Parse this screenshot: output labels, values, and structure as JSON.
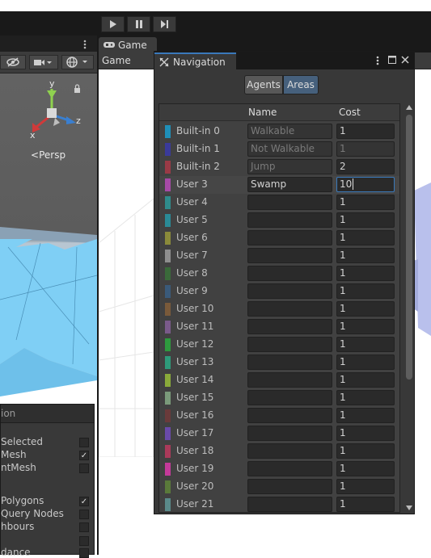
{
  "toolbar": {
    "play": "▶",
    "pause": "❚❚",
    "step": "▶|"
  },
  "game": {
    "tab_label": "Game",
    "mode_label": "Game"
  },
  "scene": {
    "axis_y": "y",
    "axis_x": "x",
    "axis_z": "z",
    "persp_label": "Persp"
  },
  "overlay": {
    "title": "ion",
    "rows": [
      {
        "label": "Selected",
        "checked": false
      },
      {
        "label": "Mesh",
        "checked": true
      },
      {
        "label": "ntMesh",
        "checked": false
      },
      {
        "label": "Polygons",
        "checked": true
      },
      {
        "label": "Query Nodes",
        "checked": false
      },
      {
        "label": "hbours",
        "checked": false
      },
      {
        "label": "dance",
        "checked": false
      }
    ]
  },
  "navigation": {
    "title": "Navigation",
    "tabs": [
      {
        "label": "Agents",
        "active": false
      },
      {
        "label": "Areas",
        "active": true
      }
    ],
    "columns": {
      "name": "Name",
      "cost": "Cost"
    },
    "areas": [
      {
        "label": "Built-in 0",
        "name": "Walkable",
        "cost": "1",
        "color": "#1f8fb8",
        "builtin": true,
        "cost_disabled": false
      },
      {
        "label": "Built-in 1",
        "name": "Not Walkable",
        "cost": "1",
        "color": "#3a3a9a",
        "builtin": true,
        "cost_disabled": true
      },
      {
        "label": "Built-in 2",
        "name": "Jump",
        "cost": "2",
        "color": "#9a3a46",
        "builtin": true,
        "cost_disabled": false
      },
      {
        "label": "User 3",
        "name": "Swamp",
        "cost": "10",
        "color": "#a64aa6",
        "builtin": false,
        "selected": true
      },
      {
        "label": "User 4",
        "name": "",
        "cost": "1",
        "color": "#2f8c8c",
        "builtin": false
      },
      {
        "label": "User 5",
        "name": "",
        "cost": "1",
        "color": "#2a8a96",
        "builtin": false
      },
      {
        "label": "User 6",
        "name": "",
        "cost": "1",
        "color": "#8a8a3a",
        "builtin": false
      },
      {
        "label": "User 7",
        "name": "",
        "cost": "1",
        "color": "#8e8e8e",
        "builtin": false
      },
      {
        "label": "User 8",
        "name": "",
        "cost": "1",
        "color": "#3a6a3a",
        "builtin": false
      },
      {
        "label": "User 9",
        "name": "",
        "cost": "1",
        "color": "#3a5a7a",
        "builtin": false
      },
      {
        "label": "User 10",
        "name": "",
        "cost": "1",
        "color": "#7a5a3a",
        "builtin": false
      },
      {
        "label": "User 11",
        "name": "",
        "cost": "1",
        "color": "#7a5a8a",
        "builtin": false
      },
      {
        "label": "User 12",
        "name": "",
        "cost": "1",
        "color": "#2e9a3e",
        "builtin": false
      },
      {
        "label": "User 13",
        "name": "",
        "cost": "1",
        "color": "#2e9a7a",
        "builtin": false
      },
      {
        "label": "User 14",
        "name": "",
        "cost": "1",
        "color": "#8aaa3a",
        "builtin": false
      },
      {
        "label": "User 15",
        "name": "",
        "cost": "1",
        "color": "#7a9a7a",
        "builtin": false
      },
      {
        "label": "User 16",
        "name": "",
        "cost": "1",
        "color": "#6a3a3a",
        "builtin": false
      },
      {
        "label": "User 17",
        "name": "",
        "cost": "1",
        "color": "#6a4aaa",
        "builtin": false
      },
      {
        "label": "User 18",
        "name": "",
        "cost": "1",
        "color": "#aa3a5a",
        "builtin": false
      },
      {
        "label": "User 19",
        "name": "",
        "cost": "1",
        "color": "#c43a9a",
        "builtin": false
      },
      {
        "label": "User 20",
        "name": "",
        "cost": "1",
        "color": "#5a7a3a",
        "builtin": false
      },
      {
        "label": "User 21",
        "name": "",
        "cost": "1",
        "color": "#5a8a8a",
        "builtin": false
      }
    ]
  },
  "colors": {
    "accent": "#3a79bb",
    "panel": "#383838",
    "dark": "#191919",
    "mesh": "#7fcff5"
  }
}
